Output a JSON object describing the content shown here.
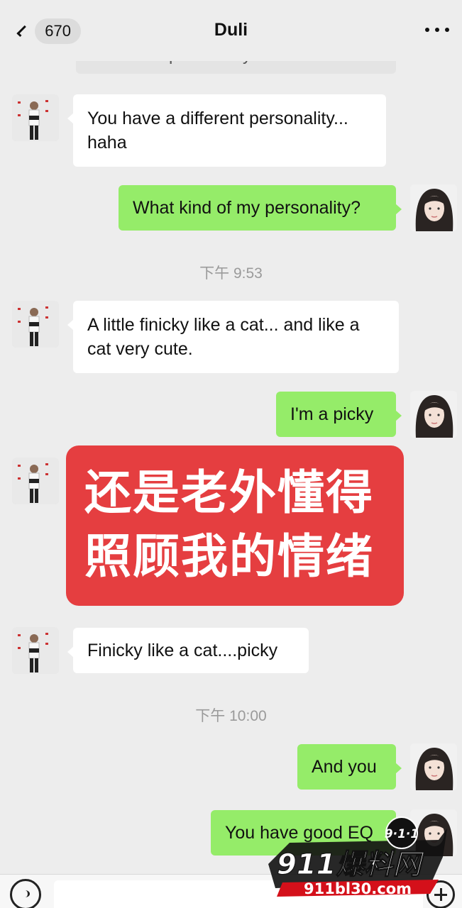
{
  "header": {
    "back_label": "670",
    "title": "Duli"
  },
  "previous_message_fragment": "a different personality",
  "messages": [
    {
      "side": "in",
      "text_lines": [
        "You have a different personality...",
        "haha"
      ]
    },
    {
      "side": "out",
      "text": "What kind of my personality?"
    },
    {
      "timestamp": "下午 9:53"
    },
    {
      "side": "in",
      "text_lines": [
        "A little finicky like a cat... and like a",
        "cat very cute."
      ]
    },
    {
      "side": "out",
      "text": "I'm a picky"
    },
    {
      "side": "in",
      "text": "Finicky like a cat....picky"
    },
    {
      "timestamp": "下午 10:00"
    },
    {
      "side": "out",
      "text": "And you"
    },
    {
      "side": "out",
      "text": "You have good EQ"
    }
  ],
  "overlay_banner": {
    "line1": "还是老外懂得",
    "line2": "照顾我的情绪",
    "color": "#e53e40"
  },
  "watermark": {
    "badge": "9·1·1",
    "brand": "911爆料网",
    "url": "911bl30.com"
  },
  "input_bar": {
    "voice_icon": "voice-icon",
    "plus_icon": "plus-icon"
  },
  "colors": {
    "outgoing_bubble": "#95ec69",
    "incoming_bubble": "#ffffff",
    "background": "#ededed"
  }
}
